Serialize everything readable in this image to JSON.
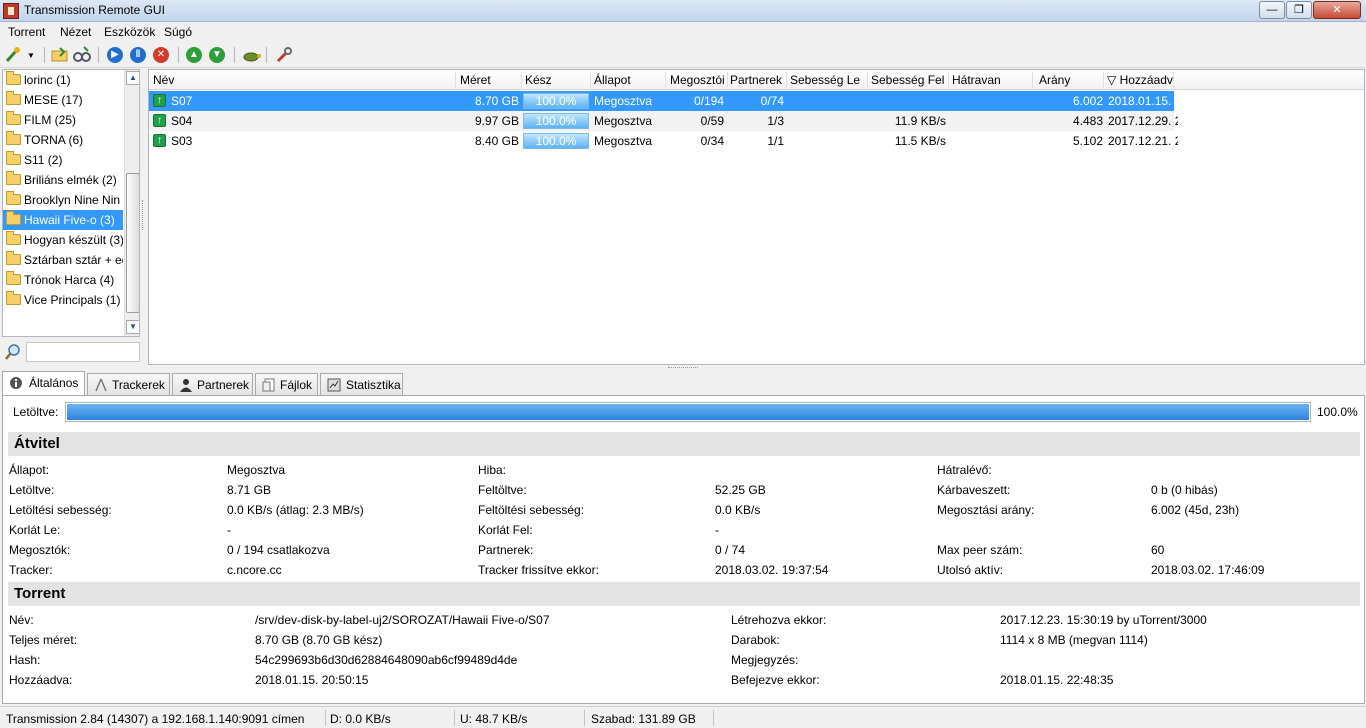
{
  "window": {
    "title": "Transmission Remote GUI"
  },
  "menu": [
    "Torrent",
    "Nézet",
    "Eszközök",
    "Súgó"
  ],
  "folders": [
    {
      "label": "lorinc (1)"
    },
    {
      "label": "MESE (17)"
    },
    {
      "label": "FILM (25)"
    },
    {
      "label": "TORNA (6)"
    },
    {
      "label": "S11 (2)"
    },
    {
      "label": "Briliáns elmék (2)"
    },
    {
      "label": "Brooklyn Nine Nin"
    },
    {
      "label": "Hawaii Five-o (3)",
      "selected": true
    },
    {
      "label": "Hogyan készült (3)"
    },
    {
      "label": "Sztárban sztár + eg"
    },
    {
      "label": "Trónok Harca (4)"
    },
    {
      "label": "Vice Principals (1)"
    }
  ],
  "torrent_columns": [
    "Név",
    "Méret",
    "Kész",
    "Állapot",
    "Megosztói",
    "Partnerek",
    "Sebesség Le",
    "Sebesség Fel",
    "Hátravan",
    "Arány",
    "▽ Hozzáadv"
  ],
  "torrents": [
    {
      "name": "S07",
      "size": "8.70 GB",
      "done": "100.0%",
      "status": "Megosztva",
      "seeds": "0/194",
      "peers": "0/74",
      "down": "",
      "up": "",
      "eta": "",
      "ratio": "6.002",
      "added": "2018.01.15. 2",
      "selected": true
    },
    {
      "name": "S04",
      "size": "9.97 GB",
      "done": "100.0%",
      "status": "Megosztva",
      "seeds": "0/59",
      "peers": "1/3",
      "down": "",
      "up": "11.9 KB/s",
      "eta": "",
      "ratio": "4.483",
      "added": "2017.12.29. 2"
    },
    {
      "name": "S03",
      "size": "8.40 GB",
      "done": "100.0%",
      "status": "Megosztva",
      "seeds": "0/34",
      "peers": "1/1",
      "down": "",
      "up": "11.5 KB/s",
      "eta": "",
      "ratio": "5.102",
      "added": "2017.12.21. 2"
    }
  ],
  "tabs": [
    "Általános",
    "Trackerek",
    "Partnerek",
    "Fájlok",
    "Statisztika"
  ],
  "general": {
    "downloaded_label": "Letöltve:",
    "downloaded_fraction": 1.0,
    "downloaded_pct": "100.0%",
    "transfer_title": "Átvitel",
    "torrent_title": "Torrent",
    "transfer": [
      [
        "Állapot:",
        "Megosztva",
        "Hiba:",
        "",
        "Hátralévő:",
        ""
      ],
      [
        "Letöltve:",
        "8.71 GB",
        "Feltöltve:",
        "52.25 GB",
        "Kárbaveszett:",
        "0 b (0 hibás)"
      ],
      [
        "Letöltési sebesség:",
        "0.0 KB/s (átlag: 2.3 MB/s)",
        "Feltöltési sebesség:",
        "0.0 KB/s",
        "Megosztási arány:",
        "6.002 (45d, 23h)"
      ],
      [
        "Korlát Le:",
        "-",
        "Korlát Fel:",
        "-",
        "",
        ""
      ],
      [
        "Megosztók:",
        "0 / 194 csatlakozva",
        "Partnerek:",
        "0 / 74",
        "Max peer szám:",
        "60"
      ],
      [
        "Tracker:",
        "c.ncore.cc",
        "Tracker frissítve ekkor:",
        "2018.03.02. 19:37:54",
        "Utolsó aktív:",
        "2018.03.02. 17:46:09"
      ]
    ],
    "torrent": [
      [
        "Név:",
        "/srv/dev-disk-by-label-uj2/SOROZAT/Hawaii Five-o/S07",
        "Létrehozva ekkor:",
        "2017.12.23. 15:30:19 by uTorrent/3000"
      ],
      [
        "Teljes méret:",
        "8.70 GB (8.70 GB kész)",
        "Darabok:",
        "1114 x 8 MB (megvan 1114)"
      ],
      [
        "Hash:",
        "54c299693b6d30d62884648090ab6cf99489d4de",
        "Megjegyzés:",
        ""
      ],
      [
        "Hozzáadva:",
        "2018.01.15. 20:50:15",
        "Befejezve ekkor:",
        "2018.01.15. 22:48:35"
      ]
    ]
  },
  "status": {
    "connection": "Transmission 2.84 (14307) a 192.168.1.140:9091 címen",
    "down": "D: 0.0 KB/s",
    "up": "U: 48.7 KB/s",
    "free": "Szabad: 131.89 GB"
  },
  "colors": {
    "selection": "#3399ff",
    "progress": "#2d84dc",
    "upload_icon": "#21a04a"
  }
}
